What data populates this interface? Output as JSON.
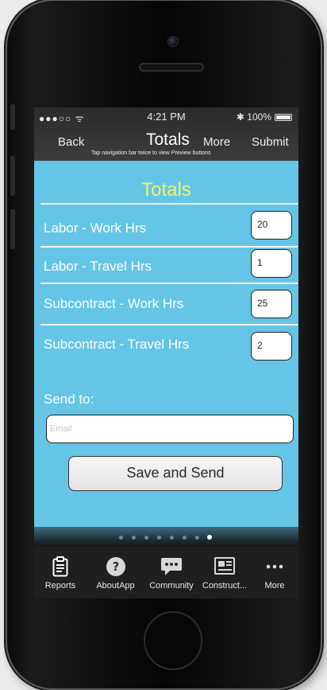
{
  "status_bar": {
    "signal": "●●●○○ ᯤ",
    "time": "4:21 PM",
    "battery": "✱ 100%"
  },
  "nav": {
    "back": "Back",
    "title": "Totals",
    "more": "More",
    "submit": "Submit",
    "hint": "Tap navigation bar twice to view Preview buttons"
  },
  "content": {
    "title": "Totals",
    "rows": [
      {
        "label": "Labor - Work Hrs",
        "value": "20"
      },
      {
        "label": "Labor - Travel Hrs",
        "value": "1"
      },
      {
        "label": "Subcontract - Work Hrs",
        "value": "25"
      },
      {
        "label": "Subcontract - Travel Hrs",
        "value": "2"
      }
    ],
    "send_label": "Send to:",
    "email_placeholder": "Email",
    "save_button": "Save and Send"
  },
  "page_indicator": {
    "count": 8,
    "active_index": 7
  },
  "tabs": [
    {
      "label": "Reports",
      "icon": "clipboard-icon"
    },
    {
      "label": "AboutApp",
      "icon": "question-icon"
    },
    {
      "label": "Community",
      "icon": "chat-bubble-icon"
    },
    {
      "label": "Construct...",
      "icon": "newspaper-icon"
    },
    {
      "label": "More",
      "icon": "ellipsis-icon"
    }
  ],
  "colors": {
    "screen_bg": "#65c5e6",
    "title_yellow": "#f5f36a",
    "bar_dark": "#1f1f1f"
  }
}
